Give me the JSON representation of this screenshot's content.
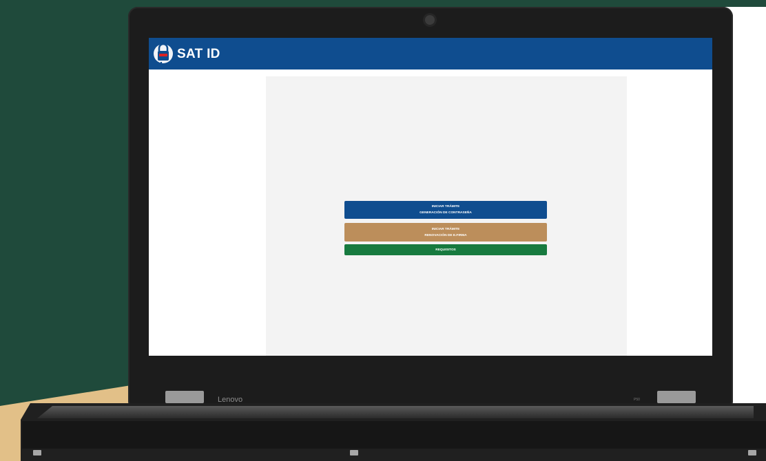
{
  "device": {
    "brand": "Lenovo",
    "model": "P50"
  },
  "app": {
    "title": "SAT ID",
    "accent_color": "#0f4d8f"
  },
  "buttons": [
    {
      "line1": "INICIAR TRÁMITE",
      "line2": "GENERACIÓN DE CONTRASEÑA",
      "color": "#0f4d8f"
    },
    {
      "line1": "INICIAR TRÁMITE",
      "line2": "RENOVACIÓN DE E.FIRMA",
      "color": "#bc8e5b"
    },
    {
      "line1": "REQUISITOS",
      "color": "#177a3f"
    }
  ]
}
